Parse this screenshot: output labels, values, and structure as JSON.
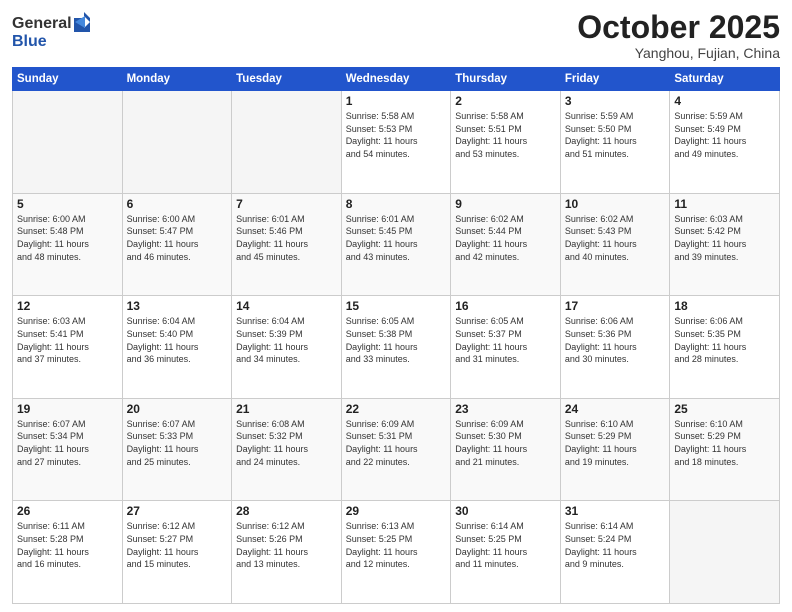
{
  "header": {
    "logo_general": "General",
    "logo_blue": "Blue",
    "month": "October 2025",
    "location": "Yanghou, Fujian, China"
  },
  "days_of_week": [
    "Sunday",
    "Monday",
    "Tuesday",
    "Wednesday",
    "Thursday",
    "Friday",
    "Saturday"
  ],
  "weeks": [
    [
      {
        "day": "",
        "info": ""
      },
      {
        "day": "",
        "info": ""
      },
      {
        "day": "",
        "info": ""
      },
      {
        "day": "1",
        "info": "Sunrise: 5:58 AM\nSunset: 5:53 PM\nDaylight: 11 hours\nand 54 minutes."
      },
      {
        "day": "2",
        "info": "Sunrise: 5:58 AM\nSunset: 5:51 PM\nDaylight: 11 hours\nand 53 minutes."
      },
      {
        "day": "3",
        "info": "Sunrise: 5:59 AM\nSunset: 5:50 PM\nDaylight: 11 hours\nand 51 minutes."
      },
      {
        "day": "4",
        "info": "Sunrise: 5:59 AM\nSunset: 5:49 PM\nDaylight: 11 hours\nand 49 minutes."
      }
    ],
    [
      {
        "day": "5",
        "info": "Sunrise: 6:00 AM\nSunset: 5:48 PM\nDaylight: 11 hours\nand 48 minutes."
      },
      {
        "day": "6",
        "info": "Sunrise: 6:00 AM\nSunset: 5:47 PM\nDaylight: 11 hours\nand 46 minutes."
      },
      {
        "day": "7",
        "info": "Sunrise: 6:01 AM\nSunset: 5:46 PM\nDaylight: 11 hours\nand 45 minutes."
      },
      {
        "day": "8",
        "info": "Sunrise: 6:01 AM\nSunset: 5:45 PM\nDaylight: 11 hours\nand 43 minutes."
      },
      {
        "day": "9",
        "info": "Sunrise: 6:02 AM\nSunset: 5:44 PM\nDaylight: 11 hours\nand 42 minutes."
      },
      {
        "day": "10",
        "info": "Sunrise: 6:02 AM\nSunset: 5:43 PM\nDaylight: 11 hours\nand 40 minutes."
      },
      {
        "day": "11",
        "info": "Sunrise: 6:03 AM\nSunset: 5:42 PM\nDaylight: 11 hours\nand 39 minutes."
      }
    ],
    [
      {
        "day": "12",
        "info": "Sunrise: 6:03 AM\nSunset: 5:41 PM\nDaylight: 11 hours\nand 37 minutes."
      },
      {
        "day": "13",
        "info": "Sunrise: 6:04 AM\nSunset: 5:40 PM\nDaylight: 11 hours\nand 36 minutes."
      },
      {
        "day": "14",
        "info": "Sunrise: 6:04 AM\nSunset: 5:39 PM\nDaylight: 11 hours\nand 34 minutes."
      },
      {
        "day": "15",
        "info": "Sunrise: 6:05 AM\nSunset: 5:38 PM\nDaylight: 11 hours\nand 33 minutes."
      },
      {
        "day": "16",
        "info": "Sunrise: 6:05 AM\nSunset: 5:37 PM\nDaylight: 11 hours\nand 31 minutes."
      },
      {
        "day": "17",
        "info": "Sunrise: 6:06 AM\nSunset: 5:36 PM\nDaylight: 11 hours\nand 30 minutes."
      },
      {
        "day": "18",
        "info": "Sunrise: 6:06 AM\nSunset: 5:35 PM\nDaylight: 11 hours\nand 28 minutes."
      }
    ],
    [
      {
        "day": "19",
        "info": "Sunrise: 6:07 AM\nSunset: 5:34 PM\nDaylight: 11 hours\nand 27 minutes."
      },
      {
        "day": "20",
        "info": "Sunrise: 6:07 AM\nSunset: 5:33 PM\nDaylight: 11 hours\nand 25 minutes."
      },
      {
        "day": "21",
        "info": "Sunrise: 6:08 AM\nSunset: 5:32 PM\nDaylight: 11 hours\nand 24 minutes."
      },
      {
        "day": "22",
        "info": "Sunrise: 6:09 AM\nSunset: 5:31 PM\nDaylight: 11 hours\nand 22 minutes."
      },
      {
        "day": "23",
        "info": "Sunrise: 6:09 AM\nSunset: 5:30 PM\nDaylight: 11 hours\nand 21 minutes."
      },
      {
        "day": "24",
        "info": "Sunrise: 6:10 AM\nSunset: 5:29 PM\nDaylight: 11 hours\nand 19 minutes."
      },
      {
        "day": "25",
        "info": "Sunrise: 6:10 AM\nSunset: 5:29 PM\nDaylight: 11 hours\nand 18 minutes."
      }
    ],
    [
      {
        "day": "26",
        "info": "Sunrise: 6:11 AM\nSunset: 5:28 PM\nDaylight: 11 hours\nand 16 minutes."
      },
      {
        "day": "27",
        "info": "Sunrise: 6:12 AM\nSunset: 5:27 PM\nDaylight: 11 hours\nand 15 minutes."
      },
      {
        "day": "28",
        "info": "Sunrise: 6:12 AM\nSunset: 5:26 PM\nDaylight: 11 hours\nand 13 minutes."
      },
      {
        "day": "29",
        "info": "Sunrise: 6:13 AM\nSunset: 5:25 PM\nDaylight: 11 hours\nand 12 minutes."
      },
      {
        "day": "30",
        "info": "Sunrise: 6:14 AM\nSunset: 5:25 PM\nDaylight: 11 hours\nand 11 minutes."
      },
      {
        "day": "31",
        "info": "Sunrise: 6:14 AM\nSunset: 5:24 PM\nDaylight: 11 hours\nand 9 minutes."
      },
      {
        "day": "",
        "info": ""
      }
    ]
  ]
}
